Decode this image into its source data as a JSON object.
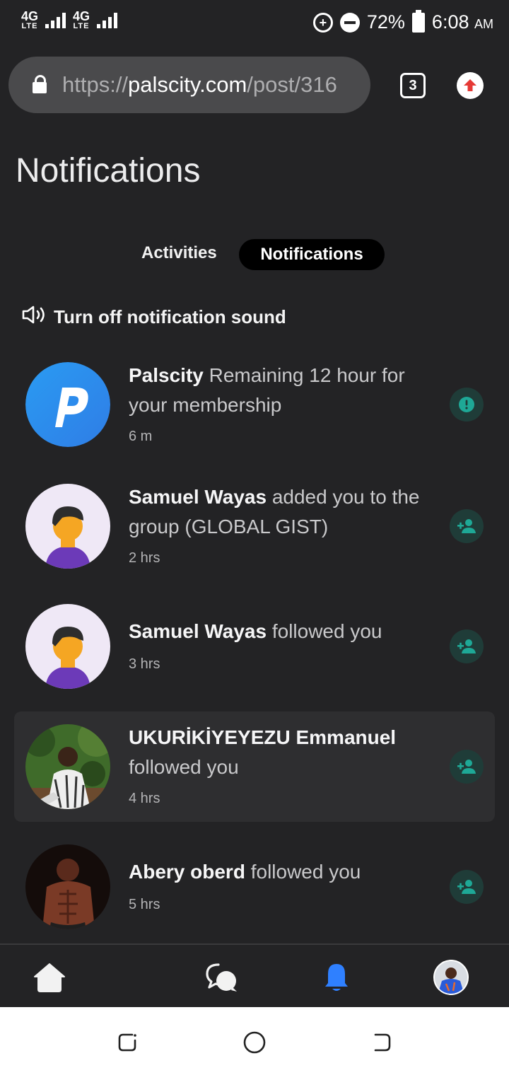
{
  "status_bar": {
    "network_1": "4G",
    "network_1_sub": "LTE",
    "network_2": "4G",
    "network_2_sub": "LTE",
    "battery": "72%",
    "time": "6:08",
    "ampm": "AM"
  },
  "browser": {
    "url_scheme": "https://",
    "url_domain": "palscity.com",
    "url_path": "/post/316",
    "tab_count": "3"
  },
  "page": {
    "title": "Notifications"
  },
  "tabs": {
    "activities": "Activities",
    "notifications": "Notifications"
  },
  "sound_toggle": {
    "label": "Turn off notification sound"
  },
  "notifications": [
    {
      "name": "Palscity",
      "text": "Remaining 12 hour for your membership",
      "time": "6 m",
      "badge_icon": "exclamation-icon",
      "avatar": "palscity-logo"
    },
    {
      "name": "Samuel Wayas",
      "text": "added you to the group (GLOBAL GIST)",
      "time": "2 hrs",
      "badge_icon": "person-add-icon",
      "avatar": "default-user-avatar"
    },
    {
      "name": "Samuel Wayas",
      "text": "followed you",
      "time": "3 hrs",
      "badge_icon": "person-add-icon",
      "avatar": "default-user-avatar"
    },
    {
      "name": "UKURİKİYEYEZU Emmanuel",
      "text": "followed you",
      "time": "4 hrs",
      "badge_icon": "person-add-icon",
      "avatar": "user-photo"
    },
    {
      "name": "Abery oberd",
      "text": "followed you",
      "time": "5 hrs",
      "badge_icon": "person-add-icon",
      "avatar": "user-photo"
    }
  ],
  "colors": {
    "background": "#232325",
    "accent_blue": "#2f80ff",
    "badge_bg": "#1f3c38",
    "badge_icon": "#1ea896"
  }
}
